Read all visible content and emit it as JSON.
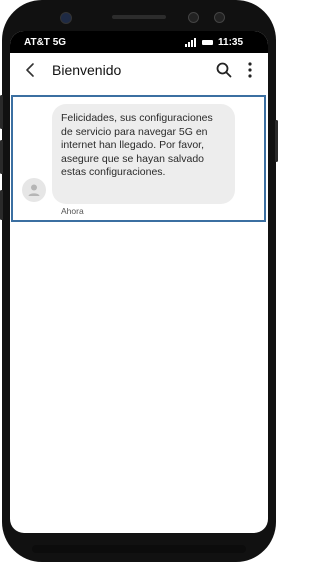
{
  "status_bar": {
    "carrier": "AT&T 5G",
    "time": "11:35",
    "icons": [
      "signal-icon",
      "battery-icon"
    ]
  },
  "conversation": {
    "title": "Bienvenido",
    "actions": [
      "back-icon",
      "search-icon",
      "more-vertical-icon"
    ]
  },
  "message": {
    "text": "Felicidades, sus configuraciones de servicio para navegar 5G en internet han llegado. Por favor, asegure que se hayan salvado estas configuraciones.",
    "timestamp": "Ahora",
    "avatar_icon": "person-icon"
  },
  "colors": {
    "highlight_border": "#3b6fa1",
    "bubble_bg": "#ededed",
    "status_bar_bg": "#000000"
  }
}
